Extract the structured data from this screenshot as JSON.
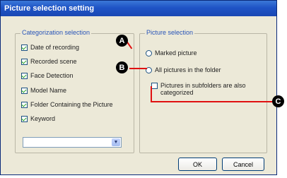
{
  "window": {
    "title": "Picture selection setting"
  },
  "categorization": {
    "legend": "Categorization selection",
    "items": [
      {
        "label": "Date of recording",
        "checked": true
      },
      {
        "label": "Recorded scene",
        "checked": true
      },
      {
        "label": "Face Detection",
        "checked": true
      },
      {
        "label": "Model Name",
        "checked": true
      },
      {
        "label": "Folder Containing the Picture",
        "checked": true
      },
      {
        "label": "Keyword",
        "checked": true
      }
    ],
    "combo_value": ""
  },
  "picture_selection": {
    "legend": "Picture selection",
    "marked_picture": "Marked picture",
    "all_pictures": "All pictures in the folder",
    "subfolders_line1": "Pictures in subfolders are also",
    "subfolders_line2": "categorized"
  },
  "buttons": {
    "ok": "OK",
    "cancel": "Cancel"
  },
  "callouts": {
    "a": "A",
    "b": "B",
    "c": "C"
  },
  "colors": {
    "callout_line": "#e01010",
    "titlebar": "#1f54c6"
  }
}
